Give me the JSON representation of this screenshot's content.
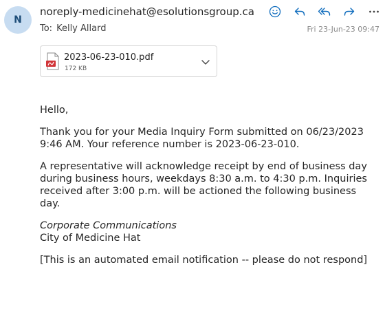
{
  "header": {
    "avatar_initial": "N",
    "sender": "noreply-medicinehat@esolutionsgroup.ca",
    "to_label": "To:",
    "to_name": "Kelly Allard",
    "date": "Fri 23-Jun-23 09:47"
  },
  "actions": [
    {
      "icon": "emoji-icon"
    },
    {
      "icon": "reply-icon"
    },
    {
      "icon": "reply-all-icon"
    },
    {
      "icon": "forward-icon"
    },
    {
      "icon": "more-icon"
    }
  ],
  "attachment": {
    "file_name": "2023-06-23-010.pdf",
    "file_size": "172 KB",
    "icon": "pdf-file-icon"
  },
  "body": {
    "greeting": "Hello,",
    "paragraph1": "Thank you for your Media Inquiry Form submitted on 06/23/2023 9:46 AM. Your reference number is 2023-06-23-010.",
    "paragraph2": "A representative will acknowledge receipt by end of business day during business hours, weekdays 8:30 a.m. to 4:30 p.m. Inquiries received after 3:00 p.m. will be actioned the following business day.",
    "signature_name": "Corporate Communications",
    "signature_org": "City of Medicine Hat",
    "footer_note": "[This is an automated email notification -- please do not respond]"
  },
  "colors": {
    "accent": "#0f6cbd",
    "avatar_bg": "#c7dcf1",
    "avatar_text": "#1f4e79"
  }
}
